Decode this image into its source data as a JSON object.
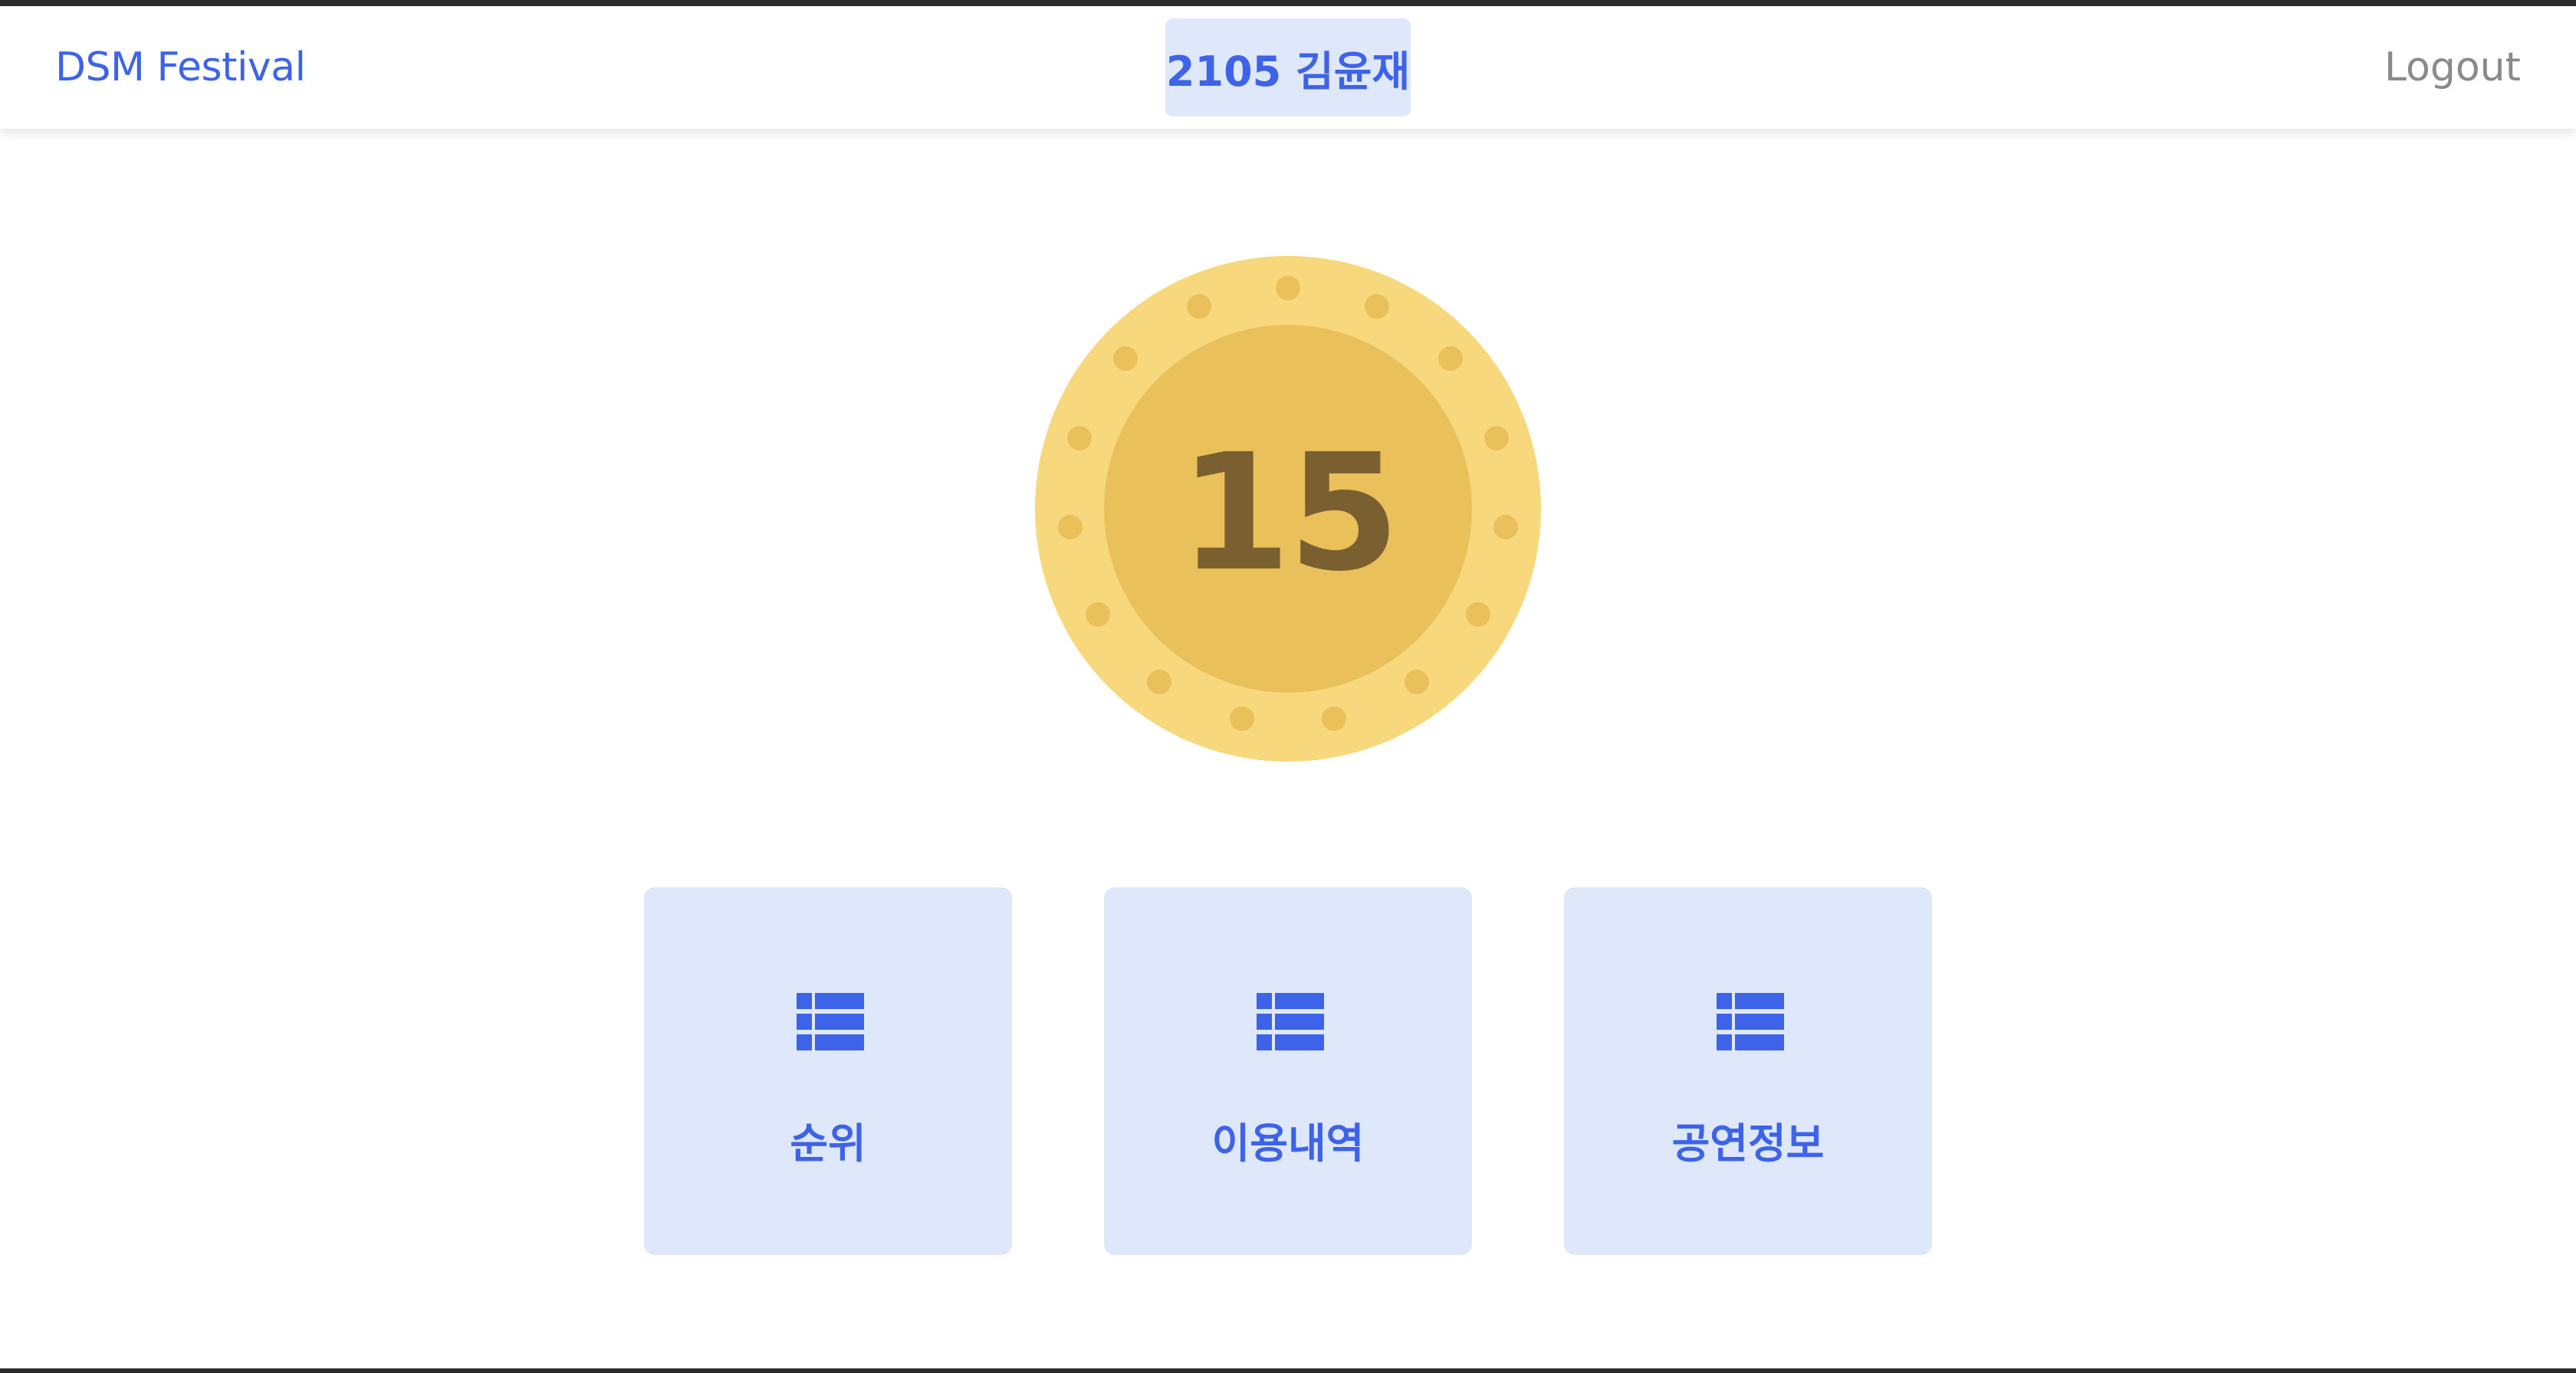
{
  "header": {
    "brand": "DSM Festival",
    "user": "2105 김윤재",
    "logout": "Logout"
  },
  "coin": {
    "value": "15",
    "icon": "coin-icon"
  },
  "menu": [
    {
      "label": "순위",
      "icon": "list-icon"
    },
    {
      "label": "이용내역",
      "icon": "list-icon"
    },
    {
      "label": "공연정보",
      "icon": "list-icon"
    }
  ],
  "colors": {
    "accent": "#3d63e8",
    "card_bg": "#dfe7fb",
    "coin_outer": "#f8d87d",
    "coin_inner": "#eac05a",
    "coin_text": "#7a6030"
  }
}
